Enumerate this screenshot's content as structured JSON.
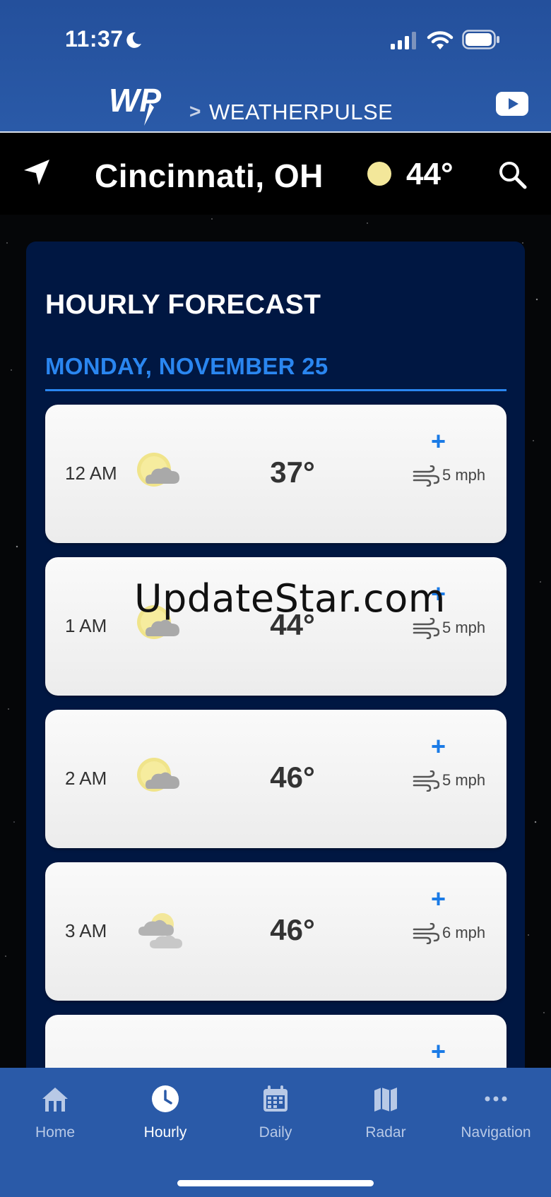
{
  "status_bar": {
    "time": "11:37"
  },
  "header": {
    "logo_text": "WP",
    "separator": ">",
    "brand_name": "WEATHERPULSE"
  },
  "location_bar": {
    "city": "Cincinnati, OH",
    "temperature": "44°"
  },
  "forecast": {
    "title": "HOURLY FORECAST",
    "date": "MONDAY, NOVEMBER 25",
    "hours": [
      {
        "time": "12 AM",
        "icon": "partly-cloudy-icon",
        "temp": "37°",
        "wind": "5 mph"
      },
      {
        "time": "1 AM",
        "icon": "partly-cloudy-icon",
        "temp": "44°",
        "wind": "5 mph"
      },
      {
        "time": "2 AM",
        "icon": "partly-cloudy-icon",
        "temp": "46°",
        "wind": "5 mph"
      },
      {
        "time": "3 AM",
        "icon": "mostly-cloudy-icon",
        "temp": "46°",
        "wind": "6 mph"
      }
    ]
  },
  "watermark": "UpdateStar.com",
  "bottom_nav": {
    "items": [
      {
        "label": "Home",
        "icon": "home-icon",
        "active": false
      },
      {
        "label": "Hourly",
        "icon": "clock-icon",
        "active": true
      },
      {
        "label": "Daily",
        "icon": "calendar-icon",
        "active": false
      },
      {
        "label": "Radar",
        "icon": "map-icon",
        "active": false
      },
      {
        "label": "Navigation",
        "icon": "more-icon",
        "active": false
      }
    ]
  },
  "colors": {
    "header_blue": "#2a5aa8",
    "panel_navy": "#001742",
    "accent_blue": "#2a86f0",
    "sun_yellow": "#f3e79a"
  }
}
